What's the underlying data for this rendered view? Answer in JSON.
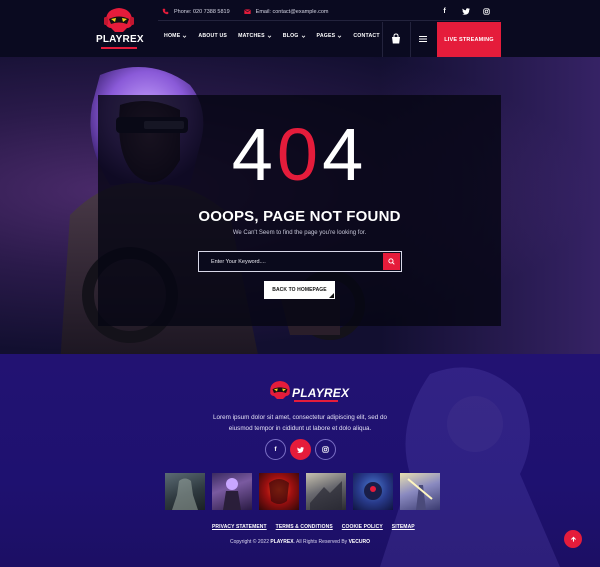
{
  "brand": {
    "name": "PLAYREX",
    "accent": "#e51c3b",
    "dark": "#0a0a20",
    "footer_bg": "#221272"
  },
  "topbar": {
    "phone": "Phone: 020 7388 5819",
    "email": "Email: contact@example.com",
    "phone_icon": "phone-icon",
    "email_icon": "envelope-icon",
    "social": [
      "f",
      "t",
      "ig"
    ]
  },
  "nav": {
    "items": [
      {
        "label": "HOME",
        "has_dropdown": true
      },
      {
        "label": "ABOUT US",
        "has_dropdown": false
      },
      {
        "label": "MATCHES",
        "has_dropdown": true
      },
      {
        "label": "BLOG",
        "has_dropdown": true
      },
      {
        "label": "PAGES",
        "has_dropdown": true
      },
      {
        "label": "CONTACT",
        "has_dropdown": false
      }
    ],
    "cta": "LIVE STREAMING"
  },
  "error": {
    "code_left": "4",
    "code_mid": "0",
    "code_right": "4",
    "title": "OOOPS, PAGE NOT FOUND",
    "subtitle": "We Can't Seem to find the page you're looking for.",
    "search_placeholder": "Enter Your Keyword....",
    "home_button": "BACK TO HOMEPAGE"
  },
  "footer": {
    "logo_text": "PLAYREX",
    "description_line1": "Lorem ipsum dolor sit amet, consectetur adipiscing elit, sed do",
    "description_line2": "eiusmod tempor in cididunt ut labore et dolo aliqua.",
    "social": [
      "f",
      "t",
      "ig"
    ],
    "links": [
      "PRIVACY STATEMENT",
      "TERMS & CONDITIONS",
      "COOKIE POLICY",
      "SITEMAP"
    ],
    "copyright_pre": "Copyright © 2022 ",
    "copyright_brand": "PLAYREX",
    "copyright_mid": ". All Rights Reserved By ",
    "copyright_owner": "VECURO"
  }
}
